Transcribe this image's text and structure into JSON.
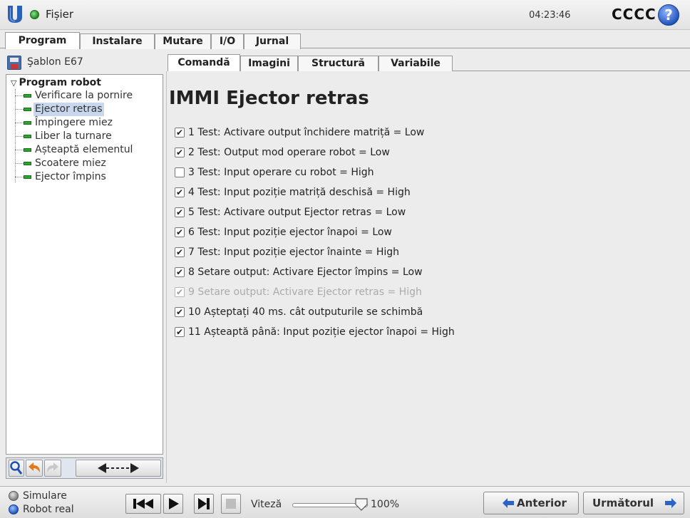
{
  "titlebar": {
    "file_label": "Fișier",
    "clock": "04:23:46",
    "robot_name": "CCCC",
    "help_symbol": "?"
  },
  "top_tabs": [
    "Program",
    "Instalare",
    "Mutare",
    "I/O",
    "Jurnal"
  ],
  "left_panel": {
    "file_name": "Şablon E67",
    "tree_root": "Program robot",
    "tree_items": [
      "Verificare la pornire",
      "Ejector retras",
      "Împingere miez",
      "Liber la turnare",
      "Așteaptă elementul",
      "Scoatere miez",
      "Ejector împins"
    ],
    "selected_index": 1
  },
  "sub_tabs": [
    "Comandă",
    "Imagini",
    "Structură",
    "Variabile"
  ],
  "command": {
    "title": "IMMI Ejector retras",
    "rows": [
      {
        "text": "1 Test: Activare output închidere matriță = Low",
        "checked": true,
        "enabled": true
      },
      {
        "text": "2 Test: Output mod operare robot = Low",
        "checked": true,
        "enabled": true
      },
      {
        "text": "3 Test: Input operare cu robot = High",
        "checked": false,
        "enabled": true
      },
      {
        "text": "4 Test: Input poziție matriță deschisă = High",
        "checked": true,
        "enabled": true
      },
      {
        "text": "5 Test: Activare output Ejector retras = Low",
        "checked": true,
        "enabled": true
      },
      {
        "text": "6 Test: Input poziție ejector înapoi = Low",
        "checked": true,
        "enabled": true
      },
      {
        "text": "7 Test: Input poziție ejector înainte = High",
        "checked": true,
        "enabled": true
      },
      {
        "text": "8 Setare output: Activare Ejector împins = Low",
        "checked": true,
        "enabled": true
      },
      {
        "text": "9 Setare output: Activare Ejector retras = High",
        "checked": true,
        "enabled": false
      },
      {
        "text": "10 Așteptați 40 ms. cât outputurile se schimbă",
        "checked": true,
        "enabled": true
      },
      {
        "text": "11 Așteaptă până: Input poziție ejector înapoi = High",
        "checked": true,
        "enabled": true
      }
    ]
  },
  "bottom": {
    "mode_simulation": "Simulare",
    "mode_real": "Robot real",
    "speed_label": "Viteză",
    "speed_value": "100%",
    "speed_fraction": 1.0,
    "prev_label": "Anterior",
    "next_label": "Următorul"
  },
  "colors": {
    "accent_blue": "#1d4fb8",
    "node_green": "#2ba52b",
    "undo_orange": "#e07a1f",
    "selection": "#c9d7ee"
  }
}
